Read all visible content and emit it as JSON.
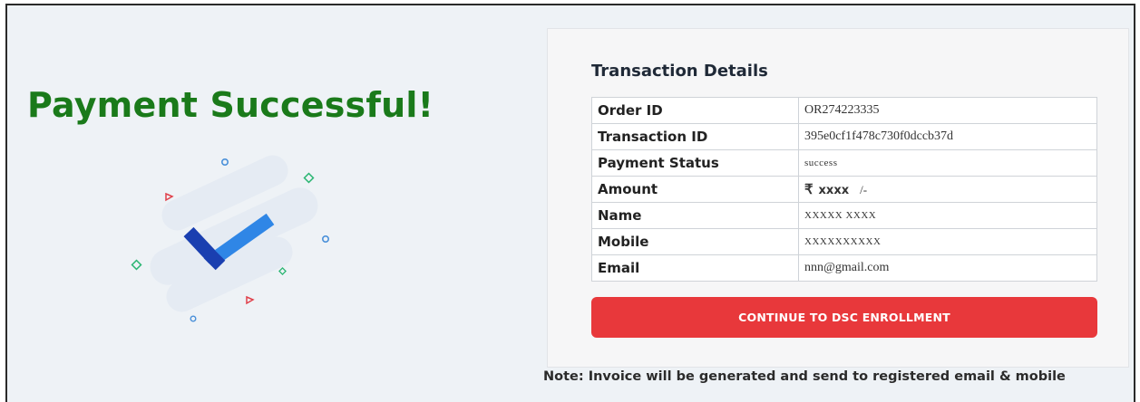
{
  "heading": "Payment Successful!",
  "transaction": {
    "title": "Transaction Details",
    "rows": [
      {
        "label": "Order ID",
        "value": "OR274223335"
      },
      {
        "label": "Transaction ID",
        "value": "395e0cf1f478c730f0dccb37d"
      },
      {
        "label": "Payment Status",
        "value": "success"
      },
      {
        "label": "Amount",
        "currency": "₹",
        "value": "xxxx",
        "suffix": "/-"
      },
      {
        "label": "Name",
        "value": "XXXXX XXXX"
      },
      {
        "label": "Mobile",
        "value": "XXXXXXXXXX"
      },
      {
        "label": "Email",
        "value": "nnn@gmail.com"
      }
    ]
  },
  "cta": {
    "label": "CONTINUE TO DSC ENROLLMENT",
    "color": "#e8383b"
  },
  "note": "Note: Invoice will be generated and send to registered email & mobile",
  "colors": {
    "heading": "#1a7a1a",
    "check_dark": "#1a3fb0",
    "check_light": "#2f86e6"
  },
  "icons": {
    "illustration": "success-check-icon"
  }
}
